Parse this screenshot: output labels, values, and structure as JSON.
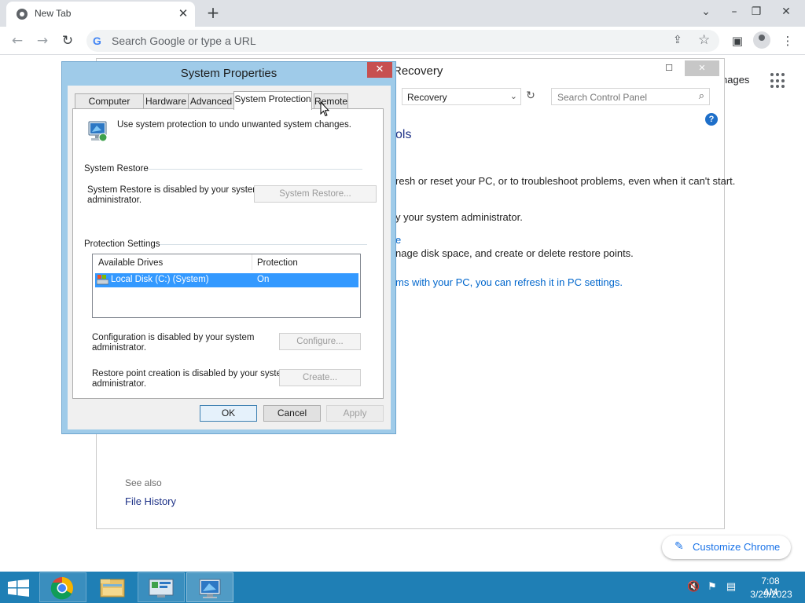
{
  "browser": {
    "tab_title": "New Tab",
    "tab_close": "✕",
    "new_tab": "+",
    "omnibox_placeholder": "Search Google or type a URL",
    "google_letter": "G",
    "images_link": "nages",
    "customize_label": "Customize Chrome",
    "icons": [
      "chrome-favicon",
      "back-arrow-icon",
      "forward-arrow-icon",
      "reload-icon",
      "share-icon",
      "bookmark-star-icon",
      "side-panel-icon",
      "profile-icon",
      "menu-kebab-icon",
      "apps-grid-icon",
      "pencil-icon"
    ]
  },
  "control_panel": {
    "title": "Recovery",
    "address": "Recovery",
    "search_placeholder": "Search Control Panel",
    "heading": "ols",
    "line1": "resh or reset your PC, or to troubleshoot problems, even when it can't start.",
    "line2": "y your system administrator.",
    "line3_link": "e",
    "line4": "nage disk space, and create or delete restore points.",
    "line5_link": "ms with your PC, you can refresh it in PC settings.",
    "see_also": "See also",
    "file_history": "File History",
    "help": "?"
  },
  "system_properties": {
    "title": "System Properties",
    "close": "✕",
    "tabs": [
      "Computer Name",
      "Hardware",
      "Advanced",
      "System Protection",
      "Remote"
    ],
    "active_tab": "System Protection",
    "intro": "Use system protection to undo unwanted system changes.",
    "system_restore_group": "System Restore",
    "system_restore_text_1": "System Restore is disabled by your system",
    "system_restore_text_2": "administrator.",
    "system_restore_button": "System Restore...",
    "protection_group": "Protection Settings",
    "list_headers": [
      "Available Drives",
      "Protection"
    ],
    "drives": [
      {
        "name": "Local Disk (C:) (System)",
        "protection": "On"
      }
    ],
    "configure_text_1": "Configuration is disabled by your system",
    "configure_text_2": "administrator.",
    "configure_button": "Configure...",
    "create_text_1": "Restore point creation is disabled by your system",
    "create_text_2": "administrator.",
    "create_button": "Create...",
    "ok": "OK",
    "cancel": "Cancel",
    "apply": "Apply"
  },
  "taskbar": {
    "apps": [
      "chrome",
      "file-explorer",
      "control-panel",
      "system-properties"
    ],
    "time": "7:08 AM",
    "date": "3/29/2023"
  },
  "colors": {
    "taskbar": "#1f7fb5",
    "dialog_frame": "#9fcbe9",
    "selection": "#3399ff",
    "link": "#0066cc"
  }
}
